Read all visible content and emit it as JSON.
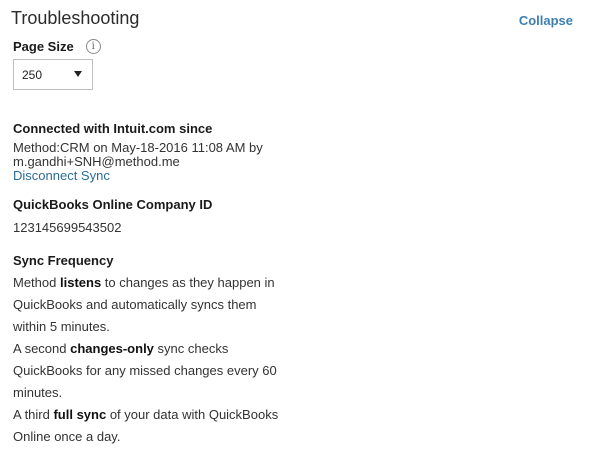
{
  "header": {
    "title": "Troubleshooting",
    "collapse_label": "Collapse"
  },
  "page_size": {
    "label": "Page Size",
    "info_icon": "info-icon",
    "selected": "250"
  },
  "connection": {
    "heading": "Connected with Intuit.com since",
    "line1": "Method:CRM on May-18-2016 11:08 AM by",
    "line2": "m.gandhi+SNH@method.me",
    "disconnect_label": "Disconnect Sync"
  },
  "company": {
    "heading": "QuickBooks Online Company ID",
    "id": "123145699543502"
  },
  "sync": {
    "heading": "Sync Frequency",
    "p1_pre": "Method ",
    "p1_bold": "listens",
    "p1_post": " to changes as they happen in QuickBooks and automatically syncs them within 5 minutes.",
    "p2_pre": "A second ",
    "p2_bold": "changes-only",
    "p2_post": " sync checks QuickBooks for any missed changes every 60 minutes.",
    "p3_pre": "A third ",
    "p3_bold": "full sync",
    "p3_post": " of your data with QuickBooks Online once a day."
  }
}
